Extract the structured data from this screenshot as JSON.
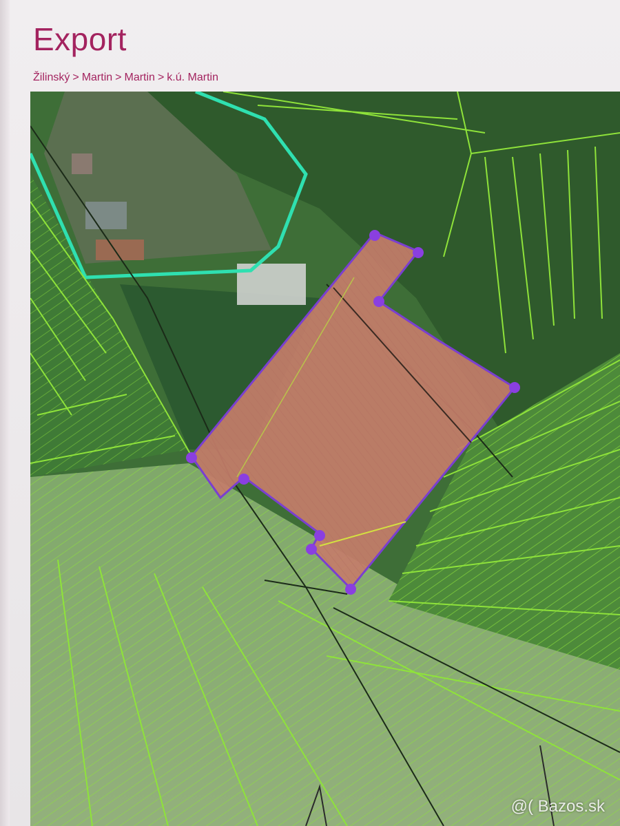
{
  "page": {
    "title": "Export"
  },
  "breadcrumb": {
    "items": [
      "Žilinský",
      "Martin",
      "Martin",
      "k.ú. Martin"
    ],
    "separator": ">"
  },
  "map": {
    "layers": {
      "selected_parcel_fill": "#c47d6a",
      "selected_parcel_outline": "#7a3fd0",
      "vertex_color": "#8a3fe0",
      "parcel_line_color": "#8fe33a",
      "boundary_color": "#2fe0b0"
    }
  },
  "watermark": {
    "text": "@( Bazos.sk"
  },
  "colors": {
    "accent": "#a3235f"
  }
}
